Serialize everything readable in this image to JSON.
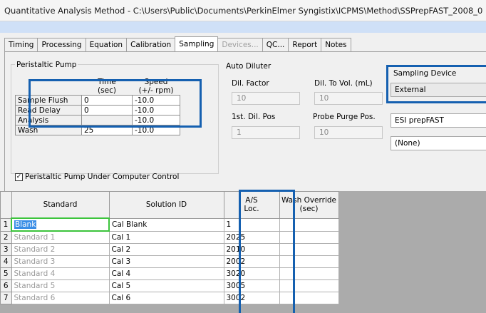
{
  "window": {
    "title": "Quantitative Analysis Method - C:\\Users\\Public\\Documents\\PerkinElmer Syngistix\\ICPMS\\Method\\SSPrepFAST_2008_0"
  },
  "tabs": [
    {
      "label": "Timing",
      "state": "normal"
    },
    {
      "label": "Processing",
      "state": "normal"
    },
    {
      "label": "Equation",
      "state": "normal"
    },
    {
      "label": "Calibration",
      "state": "normal"
    },
    {
      "label": "Sampling",
      "state": "active"
    },
    {
      "label": "Devices...",
      "state": "disabled"
    },
    {
      "label": "QC...",
      "state": "normal"
    },
    {
      "label": "Report",
      "state": "normal"
    },
    {
      "label": "Notes",
      "state": "normal"
    }
  ],
  "peristaltic_pump": {
    "title": "Peristaltic Pump",
    "col_time": "Time",
    "col_time_unit": "(sec)",
    "col_speed": "Speed",
    "col_speed_unit": "(+/- rpm)",
    "rows": [
      {
        "label": "Sample Flush",
        "time": "0",
        "speed": "-10.0"
      },
      {
        "label": "Read Delay",
        "time": "0",
        "speed": "-10.0"
      },
      {
        "label": "Analysis",
        "time": "",
        "speed": "-10.0"
      },
      {
        "label": "Wash",
        "time": "25",
        "speed": "-10.0"
      }
    ],
    "computer_control_label": "Peristaltic Pump Under Computer Control",
    "computer_control_checked": true
  },
  "auto_diluter": {
    "title": "Auto Diluter",
    "dil_factor_label": "Dil. Factor",
    "dil_factor_value": "10",
    "dil_to_vol_label": "Dil. To Vol. (mL)",
    "dil_to_vol_value": "10",
    "first_dil_pos_label": "1st. Dil. Pos",
    "first_dil_pos_value": "1",
    "probe_purge_label": "Probe Purge Pos.",
    "probe_purge_value": "10"
  },
  "sampling_device": {
    "title": "Sampling Device",
    "value": "External",
    "secondary_value": "ESI prepFAST",
    "tertiary_value": "(None)"
  },
  "standards_table": {
    "col_standard": "Standard",
    "col_solution_id": "Solution ID",
    "col_as_loc_line1": "A/S",
    "col_as_loc_line2": "Loc.",
    "col_wash_override_line1": "Wash Override",
    "col_wash_override_line2": "(sec)",
    "rows": [
      {
        "num": "1",
        "standard": "Blank",
        "solution_id": "Cal Blank",
        "as_loc": "1",
        "wash_override": ""
      },
      {
        "num": "2",
        "standard": "Standard 1",
        "solution_id": "Cal 1",
        "as_loc": "2025",
        "wash_override": ""
      },
      {
        "num": "3",
        "standard": "Standard 2",
        "solution_id": "Cal 2",
        "as_loc": "2010",
        "wash_override": ""
      },
      {
        "num": "4",
        "standard": "Standard 3",
        "solution_id": "Cal 3",
        "as_loc": "2002",
        "wash_override": ""
      },
      {
        "num": "5",
        "standard": "Standard 4",
        "solution_id": "Cal 4",
        "as_loc": "3020",
        "wash_override": ""
      },
      {
        "num": "6",
        "standard": "Standard 5",
        "solution_id": "Cal 5",
        "as_loc": "3005",
        "wash_override": ""
      },
      {
        "num": "7",
        "standard": "Standard 6",
        "solution_id": "Cal 6",
        "as_loc": "3002",
        "wash_override": ""
      }
    ]
  },
  "colors": {
    "highlight_box": "#1560b0",
    "selection_blue": "#3a8ee6",
    "selected_cell_border": "#3cc43c",
    "menu_strip": "#cfe0f7"
  }
}
